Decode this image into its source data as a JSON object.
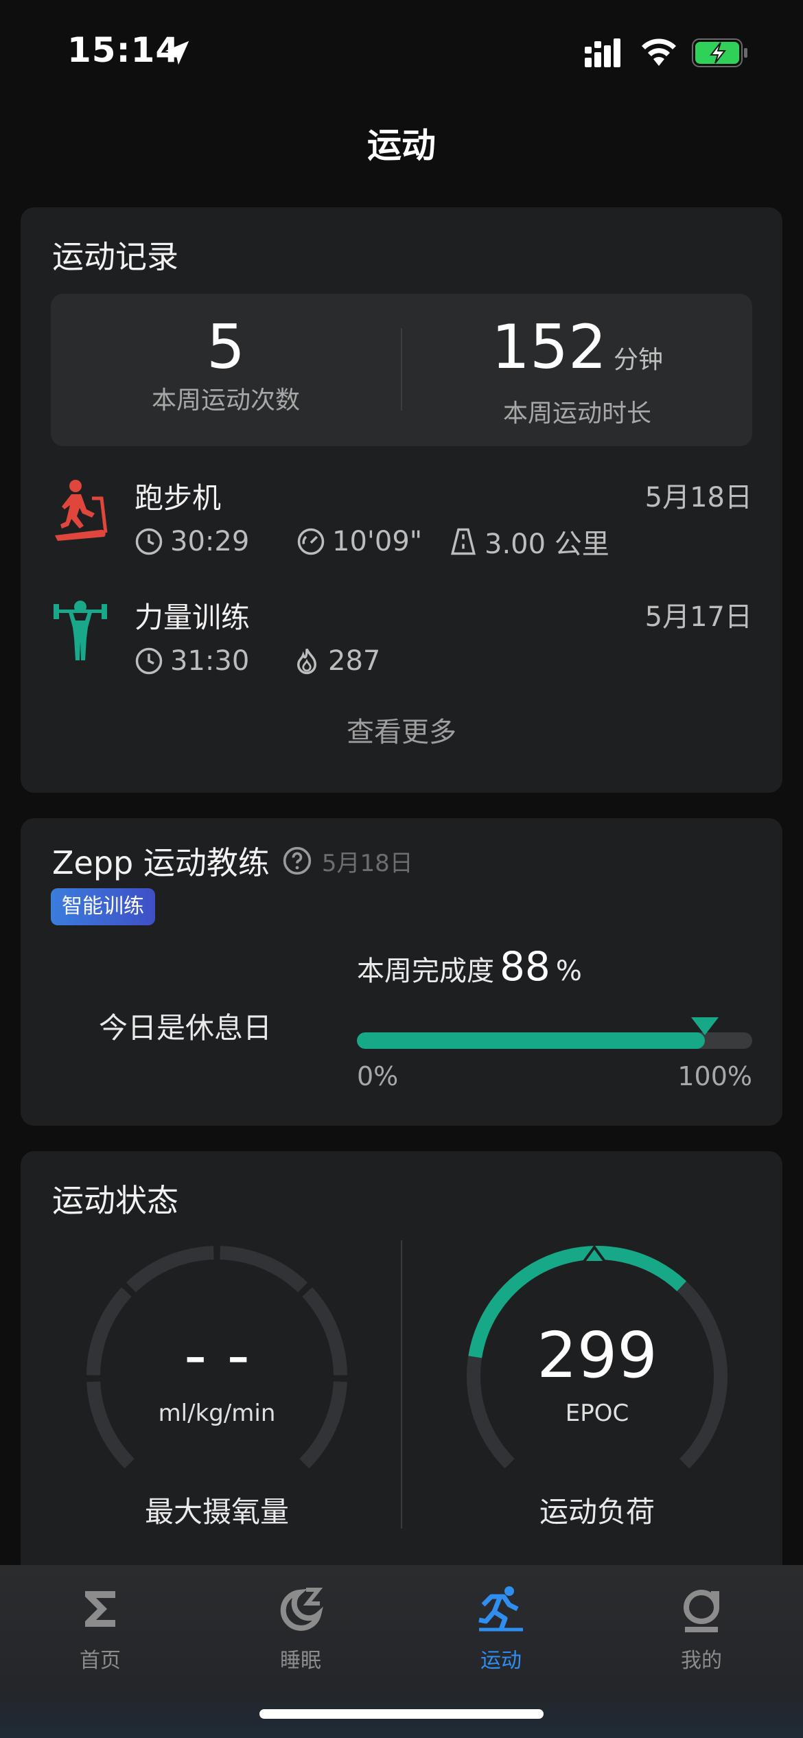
{
  "status_bar": {
    "time": "15:14"
  },
  "page": {
    "title": "运动"
  },
  "records": {
    "title": "运动记录",
    "week_count": "5",
    "week_count_label": "本周运动次数",
    "week_duration": "152",
    "week_duration_unit": "分钟",
    "week_duration_label": "本周运动时长",
    "activities": [
      {
        "name": "跑步机",
        "date": "5月18日",
        "duration": "30:29",
        "pace": "10'09\"",
        "distance": "3.00 公里"
      },
      {
        "name": "力量训练",
        "date": "5月17日",
        "duration": "31:30",
        "calories": "287"
      }
    ],
    "see_more": "查看更多"
  },
  "coach": {
    "title": "Zepp 运动教练",
    "date": "5月18日",
    "badge": "智能训练",
    "rest_text": "今日是休息日",
    "completion_label": "本周完成度",
    "completion_value": "88",
    "completion_unit": "%",
    "completion_fraction": 0.88,
    "progress_min": "0%",
    "progress_max": "100%"
  },
  "status": {
    "title": "运动状态",
    "vo2max_value": "- -",
    "vo2max_unit": "ml/kg/min",
    "vo2max_label": "最大摄氧量",
    "epoc_value": "299",
    "epoc_unit": "EPOC",
    "epoc_label": "运动负荷",
    "epoc_fraction": 0.46
  },
  "tabs": [
    {
      "label": "首页",
      "icon": "sigma-home-icon",
      "active": false
    },
    {
      "label": "睡眠",
      "icon": "moon-sleep-icon",
      "active": false
    },
    {
      "label": "运动",
      "icon": "running-icon",
      "active": true
    },
    {
      "label": "我的",
      "icon": "profile-icon",
      "active": false
    }
  ],
  "colors": {
    "accent_green": "#17a888",
    "active_tab_blue": "#2f8ef0",
    "treadmill_red": "#e0463b",
    "strength_teal": "#1aa88a",
    "badge_blue": "#3b7ddd"
  }
}
